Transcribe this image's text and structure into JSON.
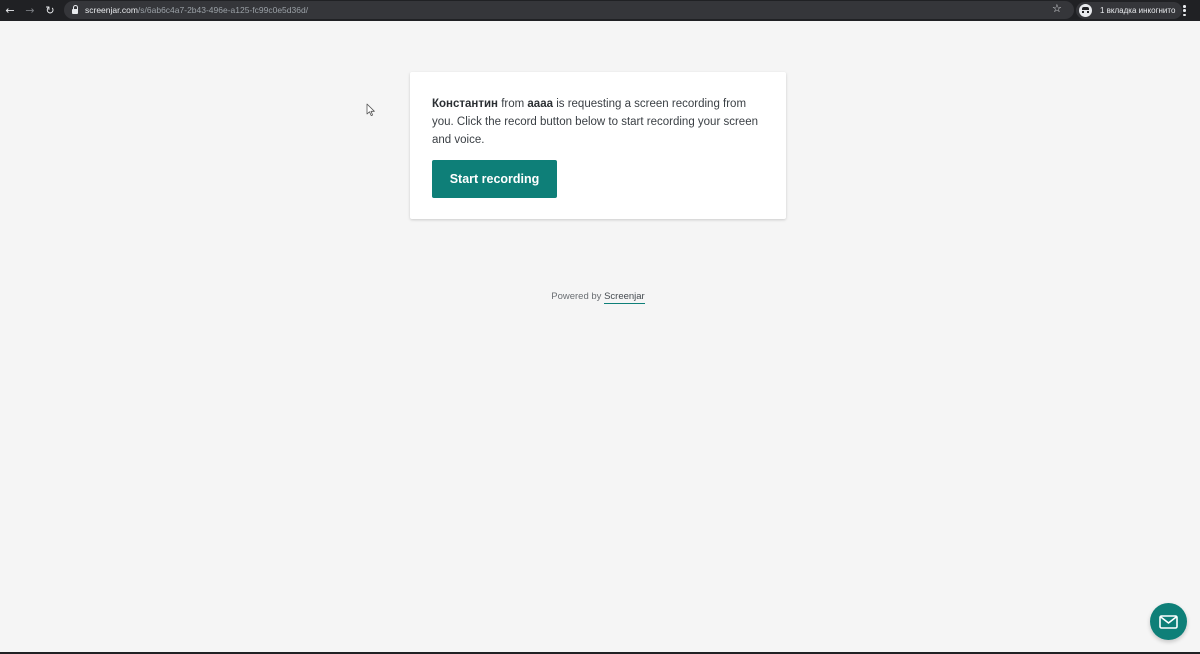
{
  "browser": {
    "url_host": "screenjar.com",
    "url_path": "/s/6ab6c4a7-2b43-496e-a125-fc99c0e5d36d/",
    "incognito_label": "1 вкладка инкогнито",
    "back_icon": "arrow-left-icon",
    "forward_icon": "arrow-right-icon",
    "reload_icon": "reload-icon",
    "bookmark_icon": "star-icon",
    "menu_icon": "kebab-menu-icon"
  },
  "card": {
    "requester_name": "Константин",
    "from_word": " from ",
    "company": "aaaa",
    "message_rest": " is requesting a screen recording from you. Click the record button below to start recording your screen and voice.",
    "button_label": "Start recording"
  },
  "footer": {
    "powered_by": "Powered by ",
    "brand_link": "Screenjar"
  },
  "chat": {
    "icon": "mail-icon"
  },
  "colors": {
    "accent": "#0e7f78",
    "background": "#f5f5f5",
    "toolbar": "#202124"
  }
}
